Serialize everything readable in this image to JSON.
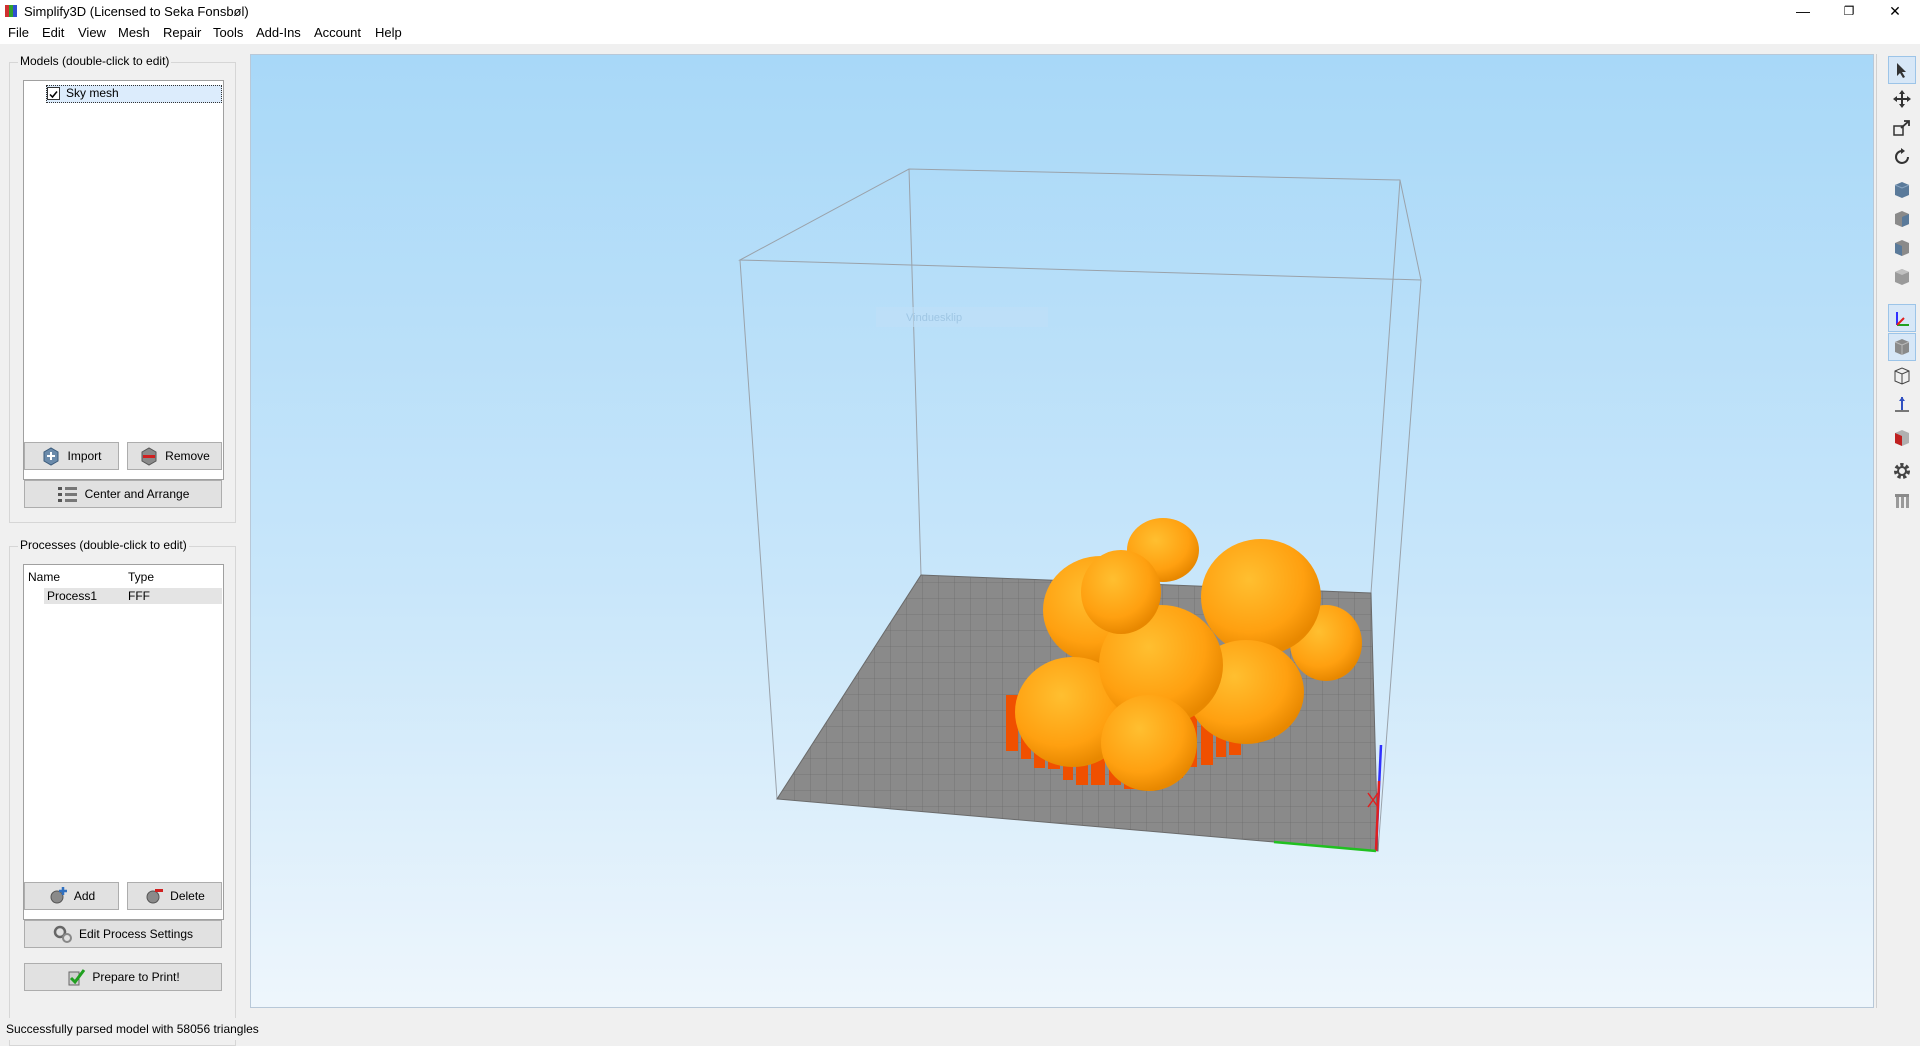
{
  "window": {
    "title": "Simplify3D (Licensed to Seka Fonsbøl)",
    "minimize": "—",
    "restore": "❐",
    "close": "✕"
  },
  "menu": [
    "File",
    "Edit",
    "View",
    "Mesh",
    "Repair",
    "Tools",
    "Add-Ins",
    "Account",
    "Help"
  ],
  "models": {
    "label": "Models (double-click to edit)",
    "items": [
      {
        "name": "Sky mesh",
        "checked": true
      }
    ],
    "import_label": "Import",
    "remove_label": "Remove",
    "center_label": "Center and Arrange"
  },
  "processes": {
    "label": "Processes (double-click to edit)",
    "columns": [
      "Name",
      "Type"
    ],
    "rows": [
      {
        "name": "Process1",
        "type": "FFF"
      }
    ],
    "add_label": "Add",
    "delete_label": "Delete",
    "edit_label": "Edit Process Settings",
    "prepare_label": "Prepare to Print!"
  },
  "viewport": {
    "watermark": "Vinduesklip"
  },
  "toolbar_icons": [
    "select-arrow-icon",
    "move-icon",
    "scale-icon",
    "rotate-icon",
    "default-view-icon",
    "front-view-icon",
    "left-view-icon",
    "right-view-icon",
    "axes-icon",
    "solid-view-icon",
    "wireframe-icon",
    "build-volume-axis-icon",
    "cross-section-icon",
    "settings-gear-icon",
    "support-icon"
  ],
  "status": {
    "text": "Successfully parsed model with 58056 triangles"
  },
  "colors": {
    "model": "#ffa010",
    "support": "#f05000",
    "bed": "#8a8a8a"
  }
}
